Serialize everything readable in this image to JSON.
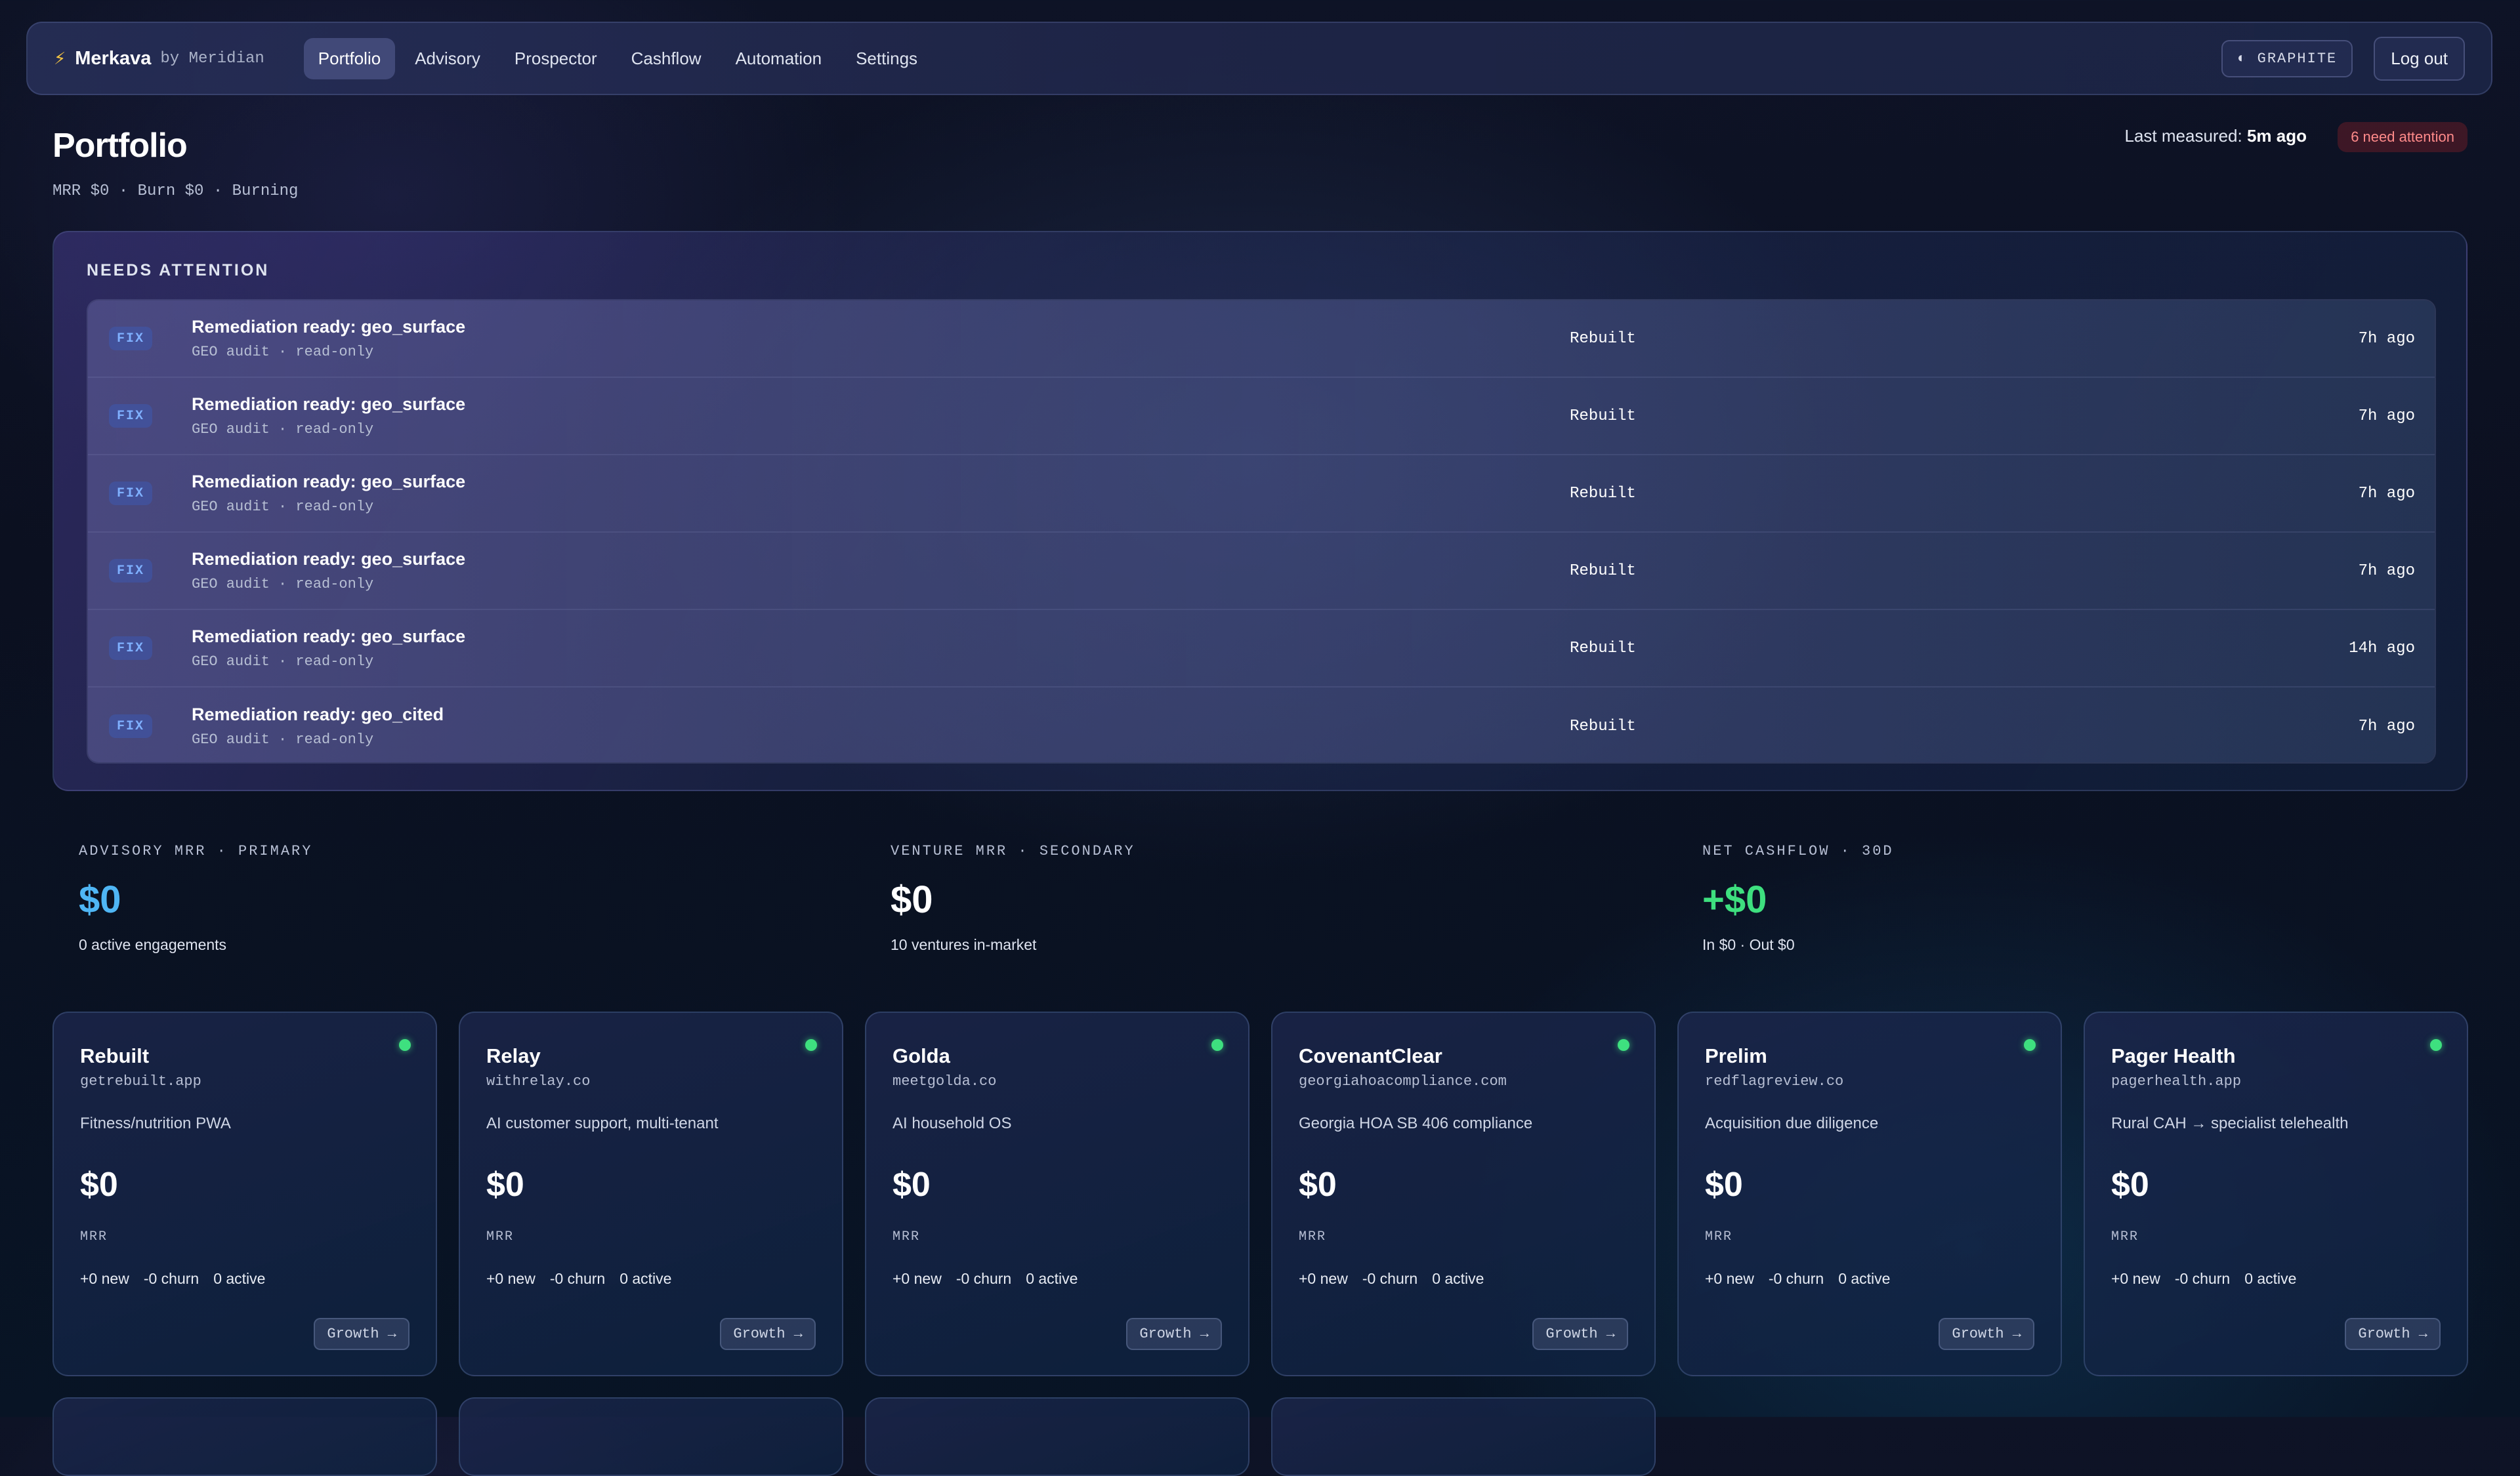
{
  "nav": {
    "brand_icon": "bolt-icon",
    "brand": "Merkava",
    "brand_by": "by Meridian",
    "tabs": [
      "Portfolio",
      "Advisory",
      "Prospector",
      "Cashflow",
      "Automation",
      "Settings"
    ],
    "active_tab": "Portfolio",
    "theme_label": "◐ GRAPHITE",
    "logout_label": "Log out"
  },
  "header": {
    "title": "Portfolio",
    "subtitle": "MRR $0 · Burn $0 · Burning",
    "measured_label": "Last measured:",
    "measured_value": "5m ago",
    "attention_badge": "6 need attention"
  },
  "attention": {
    "title": "NEEDS ATTENTION",
    "items": [
      {
        "tag": "FIX",
        "title": "Remediation ready: geo_surface",
        "meta": "GEO audit · read-only",
        "venture": "Rebuilt",
        "time": "7h ago"
      },
      {
        "tag": "FIX",
        "title": "Remediation ready: geo_surface",
        "meta": "GEO audit · read-only",
        "venture": "Rebuilt",
        "time": "7h ago"
      },
      {
        "tag": "FIX",
        "title": "Remediation ready: geo_surface",
        "meta": "GEO audit · read-only",
        "venture": "Rebuilt",
        "time": "7h ago"
      },
      {
        "tag": "FIX",
        "title": "Remediation ready: geo_surface",
        "meta": "GEO audit · read-only",
        "venture": "Rebuilt",
        "time": "7h ago"
      },
      {
        "tag": "FIX",
        "title": "Remediation ready: geo_surface",
        "meta": "GEO audit · read-only",
        "venture": "Rebuilt",
        "time": "14h ago"
      },
      {
        "tag": "FIX",
        "title": "Remediation ready: geo_cited",
        "meta": "GEO audit · read-only",
        "venture": "Rebuilt",
        "time": "7h ago"
      }
    ]
  },
  "metrics": [
    {
      "label": "ADVISORY MRR · PRIMARY",
      "value": "$0",
      "sub": "0 active engagements",
      "color": "#4fb6f5"
    },
    {
      "label": "VENTURE MRR · SECONDARY",
      "value": "$0",
      "sub": "10 ventures in-market",
      "color": "#ffffff"
    },
    {
      "label": "NET CASHFLOW · 30D",
      "value": "+$0",
      "sub": "In $0 · Out $0",
      "color": "#3ee07f"
    }
  ],
  "ventures": [
    {
      "name": "Rebuilt",
      "domain": "getrebuilt.app",
      "desc": "Fitness/nutrition PWA",
      "mrr": "$0",
      "mrr_label": "MRR",
      "new": "+0 new",
      "churn": "-0 churn",
      "active": "0 active",
      "button": "Growth →"
    },
    {
      "name": "Relay",
      "domain": "withrelay.co",
      "desc": "AI customer support, multi-tenant",
      "mrr": "$0",
      "mrr_label": "MRR",
      "new": "+0 new",
      "churn": "-0 churn",
      "active": "0 active",
      "button": "Growth →"
    },
    {
      "name": "Golda",
      "domain": "meetgolda.co",
      "desc": "AI household OS",
      "mrr": "$0",
      "mrr_label": "MRR",
      "new": "+0 new",
      "churn": "-0 churn",
      "active": "0 active",
      "button": "Growth →"
    },
    {
      "name": "CovenantClear",
      "domain": "georgiahoacompliance.com",
      "desc": "Georgia HOA SB 406 compliance",
      "mrr": "$0",
      "mrr_label": "MRR",
      "new": "+0 new",
      "churn": "-0 churn",
      "active": "0 active",
      "button": "Growth →"
    },
    {
      "name": "Prelim",
      "domain": "redflagreview.co",
      "desc": "Acquisition due diligence",
      "mrr": "$0",
      "mrr_label": "MRR",
      "new": "+0 new",
      "churn": "-0 churn",
      "active": "0 active",
      "button": "Growth →"
    },
    {
      "name": "Pager Health",
      "domain": "pagerhealth.app",
      "desc": "Rural CAH → specialist telehealth",
      "mrr": "$0",
      "mrr_label": "MRR",
      "new": "+0 new",
      "churn": "-0 churn",
      "active": "0 active",
      "button": "Growth →"
    }
  ],
  "status_color": "#3ee07f"
}
